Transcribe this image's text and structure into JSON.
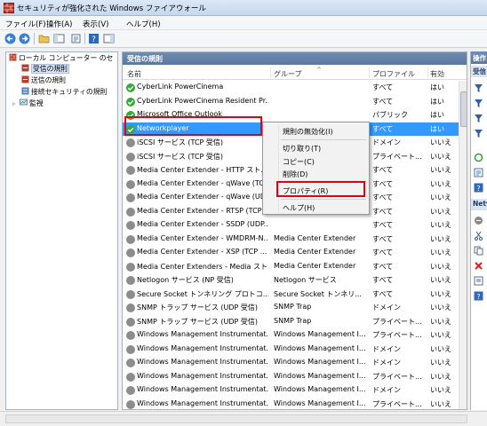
{
  "window": {
    "title": "セキュリティが強化された Windows ファイアウォール"
  },
  "menu": [
    "ファイル(F)",
    "操作(A)",
    "表示(V)",
    "ヘルプ(H)"
  ],
  "tree": {
    "root": "ローカル コンピューター のセ",
    "items": [
      "受信の規則",
      "送信の規則",
      "接続セキュリティの規則",
      "監視"
    ]
  },
  "center": {
    "header": "受信の規則",
    "columns": [
      "名前",
      "グループ",
      "プロファイル",
      "有効"
    ],
    "rows": [
      {
        "name": "CyberLink PowerCinema",
        "group": "",
        "profile": "すべて",
        "enabled": "はい",
        "icon": "check"
      },
      {
        "name": "CyberLink PowerCinema Resident Pr...",
        "group": "",
        "profile": "すべて",
        "enabled": "はい",
        "icon": "check"
      },
      {
        "name": "Microsoft Office Outlook",
        "group": "",
        "profile": "パブリック",
        "enabled": "はい",
        "icon": "check"
      },
      {
        "name": "Networkplayer",
        "group": "",
        "profile": "すべて",
        "enabled": "はい",
        "icon": "check",
        "selected": true
      },
      {
        "name": "iSCSI サービス (TCP 受信)",
        "group": "",
        "profile": "ドメイン",
        "enabled": "いいえ",
        "icon": "gray"
      },
      {
        "name": "iSCSI サービス (TCP 受信)",
        "group": "",
        "profile": "プライベート...",
        "enabled": "いいえ",
        "icon": "gray"
      },
      {
        "name": "Media Center Extender - HTTP スト...",
        "group": "",
        "profile": "すべて",
        "enabled": "いいえ",
        "icon": "gray"
      },
      {
        "name": "Media Center Extender - qWave (TC...",
        "group": "",
        "profile": "すべて",
        "enabled": "いいえ",
        "icon": "gray"
      },
      {
        "name": "Media Center Extender - qWave (UD...",
        "group": "",
        "profile": "すべて",
        "enabled": "いいえ",
        "icon": "gray"
      },
      {
        "name": "Media Center Extender - RTSP (TCP ...",
        "group": "",
        "profile": "すべて",
        "enabled": "いいえ",
        "icon": "gray"
      },
      {
        "name": "Media Center Extender - SSDP (UDP...",
        "group": "",
        "profile": "すべて",
        "enabled": "いいえ",
        "icon": "gray"
      },
      {
        "name": "Media Center Extender - WMDRM-N...",
        "group": "Media Center Extender",
        "profile": "すべて",
        "enabled": "いいえ",
        "icon": "gray"
      },
      {
        "name": "Media Center Extender - XSP (TCP ...",
        "group": "Media Center Extender",
        "profile": "すべて",
        "enabled": "いいえ",
        "icon": "gray"
      },
      {
        "name": "Media Center Extenders - Media スト...",
        "group": "Media Center Extender",
        "profile": "すべて",
        "enabled": "いいえ",
        "icon": "gray"
      },
      {
        "name": "Netlogon サービス (NP 受信)",
        "group": "Netlogon サービス",
        "profile": "すべて",
        "enabled": "いいえ",
        "icon": "gray"
      },
      {
        "name": "Secure Socket トンネリング プロトコ...",
        "group": "Secure Socket トンネリ...",
        "profile": "すべて",
        "enabled": "いいえ",
        "icon": "gray"
      },
      {
        "name": "SNMP トラップ サービス (UDP 受信)",
        "group": "SNMP Trap",
        "profile": "ドメイン",
        "enabled": "いいえ",
        "icon": "gray"
      },
      {
        "name": "SNMP トラップ サービス (UDP 受信)",
        "group": "SNMP Trap",
        "profile": "プライベート...",
        "enabled": "いいえ",
        "icon": "gray"
      },
      {
        "name": "Windows Management Instrumentat...",
        "group": "Windows Management I...",
        "profile": "プライベート...",
        "enabled": "いいえ",
        "icon": "gray"
      },
      {
        "name": "Windows Management Instrumentat...",
        "group": "Windows Management I...",
        "profile": "ドメイン",
        "enabled": "いいえ",
        "icon": "gray"
      },
      {
        "name": "Windows Management Instrumentat...",
        "group": "Windows Management I...",
        "profile": "ドメイン",
        "enabled": "いいえ",
        "icon": "gray"
      },
      {
        "name": "Windows Management Instrumentat...",
        "group": "Windows Management I...",
        "profile": "プライベート...",
        "enabled": "いいえ",
        "icon": "gray"
      },
      {
        "name": "Windows Management Instrumentat...",
        "group": "Windows Management I...",
        "profile": "ドメイン",
        "enabled": "いいえ",
        "icon": "gray"
      },
      {
        "name": "Windows Management Instrumentat...",
        "group": "Windows Management I...",
        "profile": "プライベート...",
        "enabled": "いいえ",
        "icon": "gray"
      }
    ]
  },
  "context_menu": [
    "規則の無効化(I)",
    "切り取り(T)",
    "コピー(C)",
    "削除(D)",
    "プロパティ(R)",
    "ヘルプ(H)"
  ],
  "actions": {
    "header": "操作",
    "section1": "受信",
    "section2": "Netw"
  },
  "colors": {
    "selection": "#3399ff",
    "highlight_box": "#e60012",
    "pane_header": "#6f8cb3",
    "enabled_icon": "#3aa83a"
  }
}
